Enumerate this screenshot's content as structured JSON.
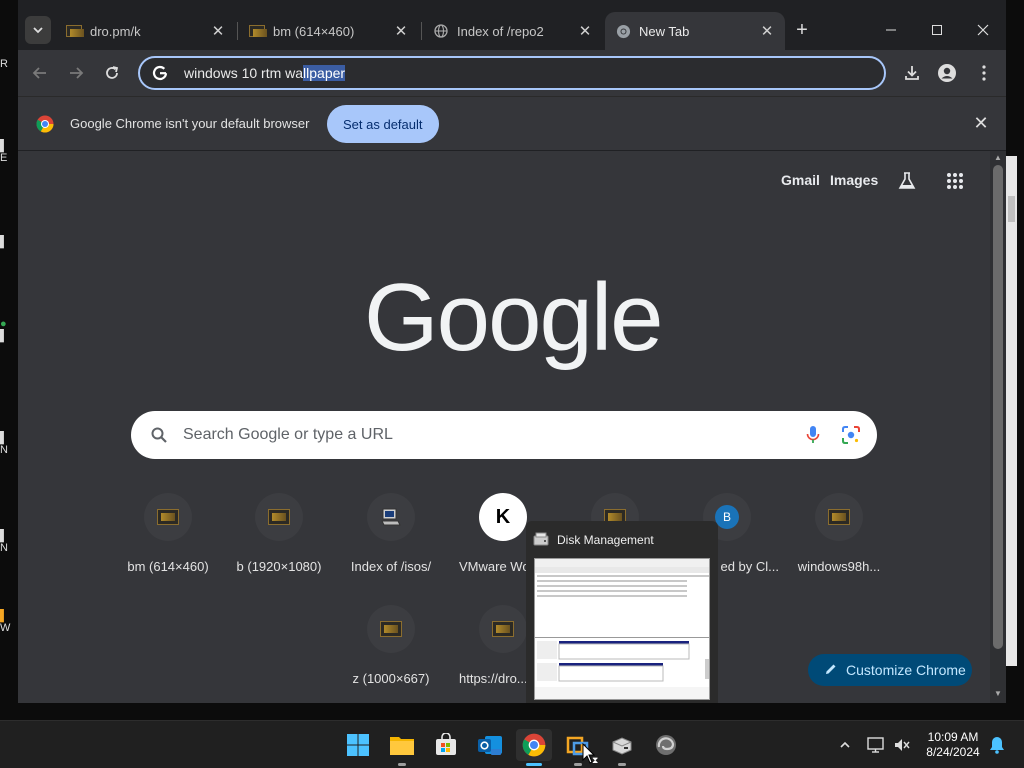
{
  "tabs": [
    {
      "title": "dro.pm/k",
      "icon": "bm-favicon"
    },
    {
      "title": "bm (614×460)",
      "icon": "bm-favicon"
    },
    {
      "title": "Index of /repo2",
      "icon": "globe-icon"
    },
    {
      "title": "New Tab",
      "icon": "chrome-icon",
      "active": true
    }
  ],
  "omnibox": {
    "text_plain": "windows 10 rtm wa",
    "text_selected": "llpaper"
  },
  "infobar": {
    "message": "Google Chrome isn't your default browser",
    "button": "Set as default"
  },
  "ntp": {
    "links": {
      "gmail": "Gmail",
      "images": "Images"
    },
    "logo": "Google",
    "search_placeholder": "Search Google or type a URL",
    "shortcuts": [
      {
        "label": "bm (614×460)",
        "icon": "bm-favicon"
      },
      {
        "label": "b (1920×1080)",
        "icon": "bm-favicon"
      },
      {
        "label": "Index of /isos/",
        "icon": "computer-icon"
      },
      {
        "label": "VMware Wo",
        "icon": "k-icon",
        "glyph": "K"
      },
      {
        "label": "",
        "icon": "bm-favicon"
      },
      {
        "label": "ed by Cl...",
        "icon": "b-icon",
        "glyph": "B"
      },
      {
        "label": "windows98h...",
        "icon": "bm-favicon"
      },
      {
        "label": "z (1000×667)",
        "icon": "bm-favicon"
      },
      {
        "label": "https://dro...",
        "icon": "bm-favicon"
      }
    ],
    "customize": "Customize Chrome"
  },
  "popup": {
    "title": "Disk Management"
  },
  "clock": {
    "time": "10:09 AM",
    "date": "8/24/2024"
  },
  "colors": {
    "accent": "#a8c7fa",
    "customize_bg": "#004a77",
    "taskbar_indicator": "#4cc2ff"
  }
}
